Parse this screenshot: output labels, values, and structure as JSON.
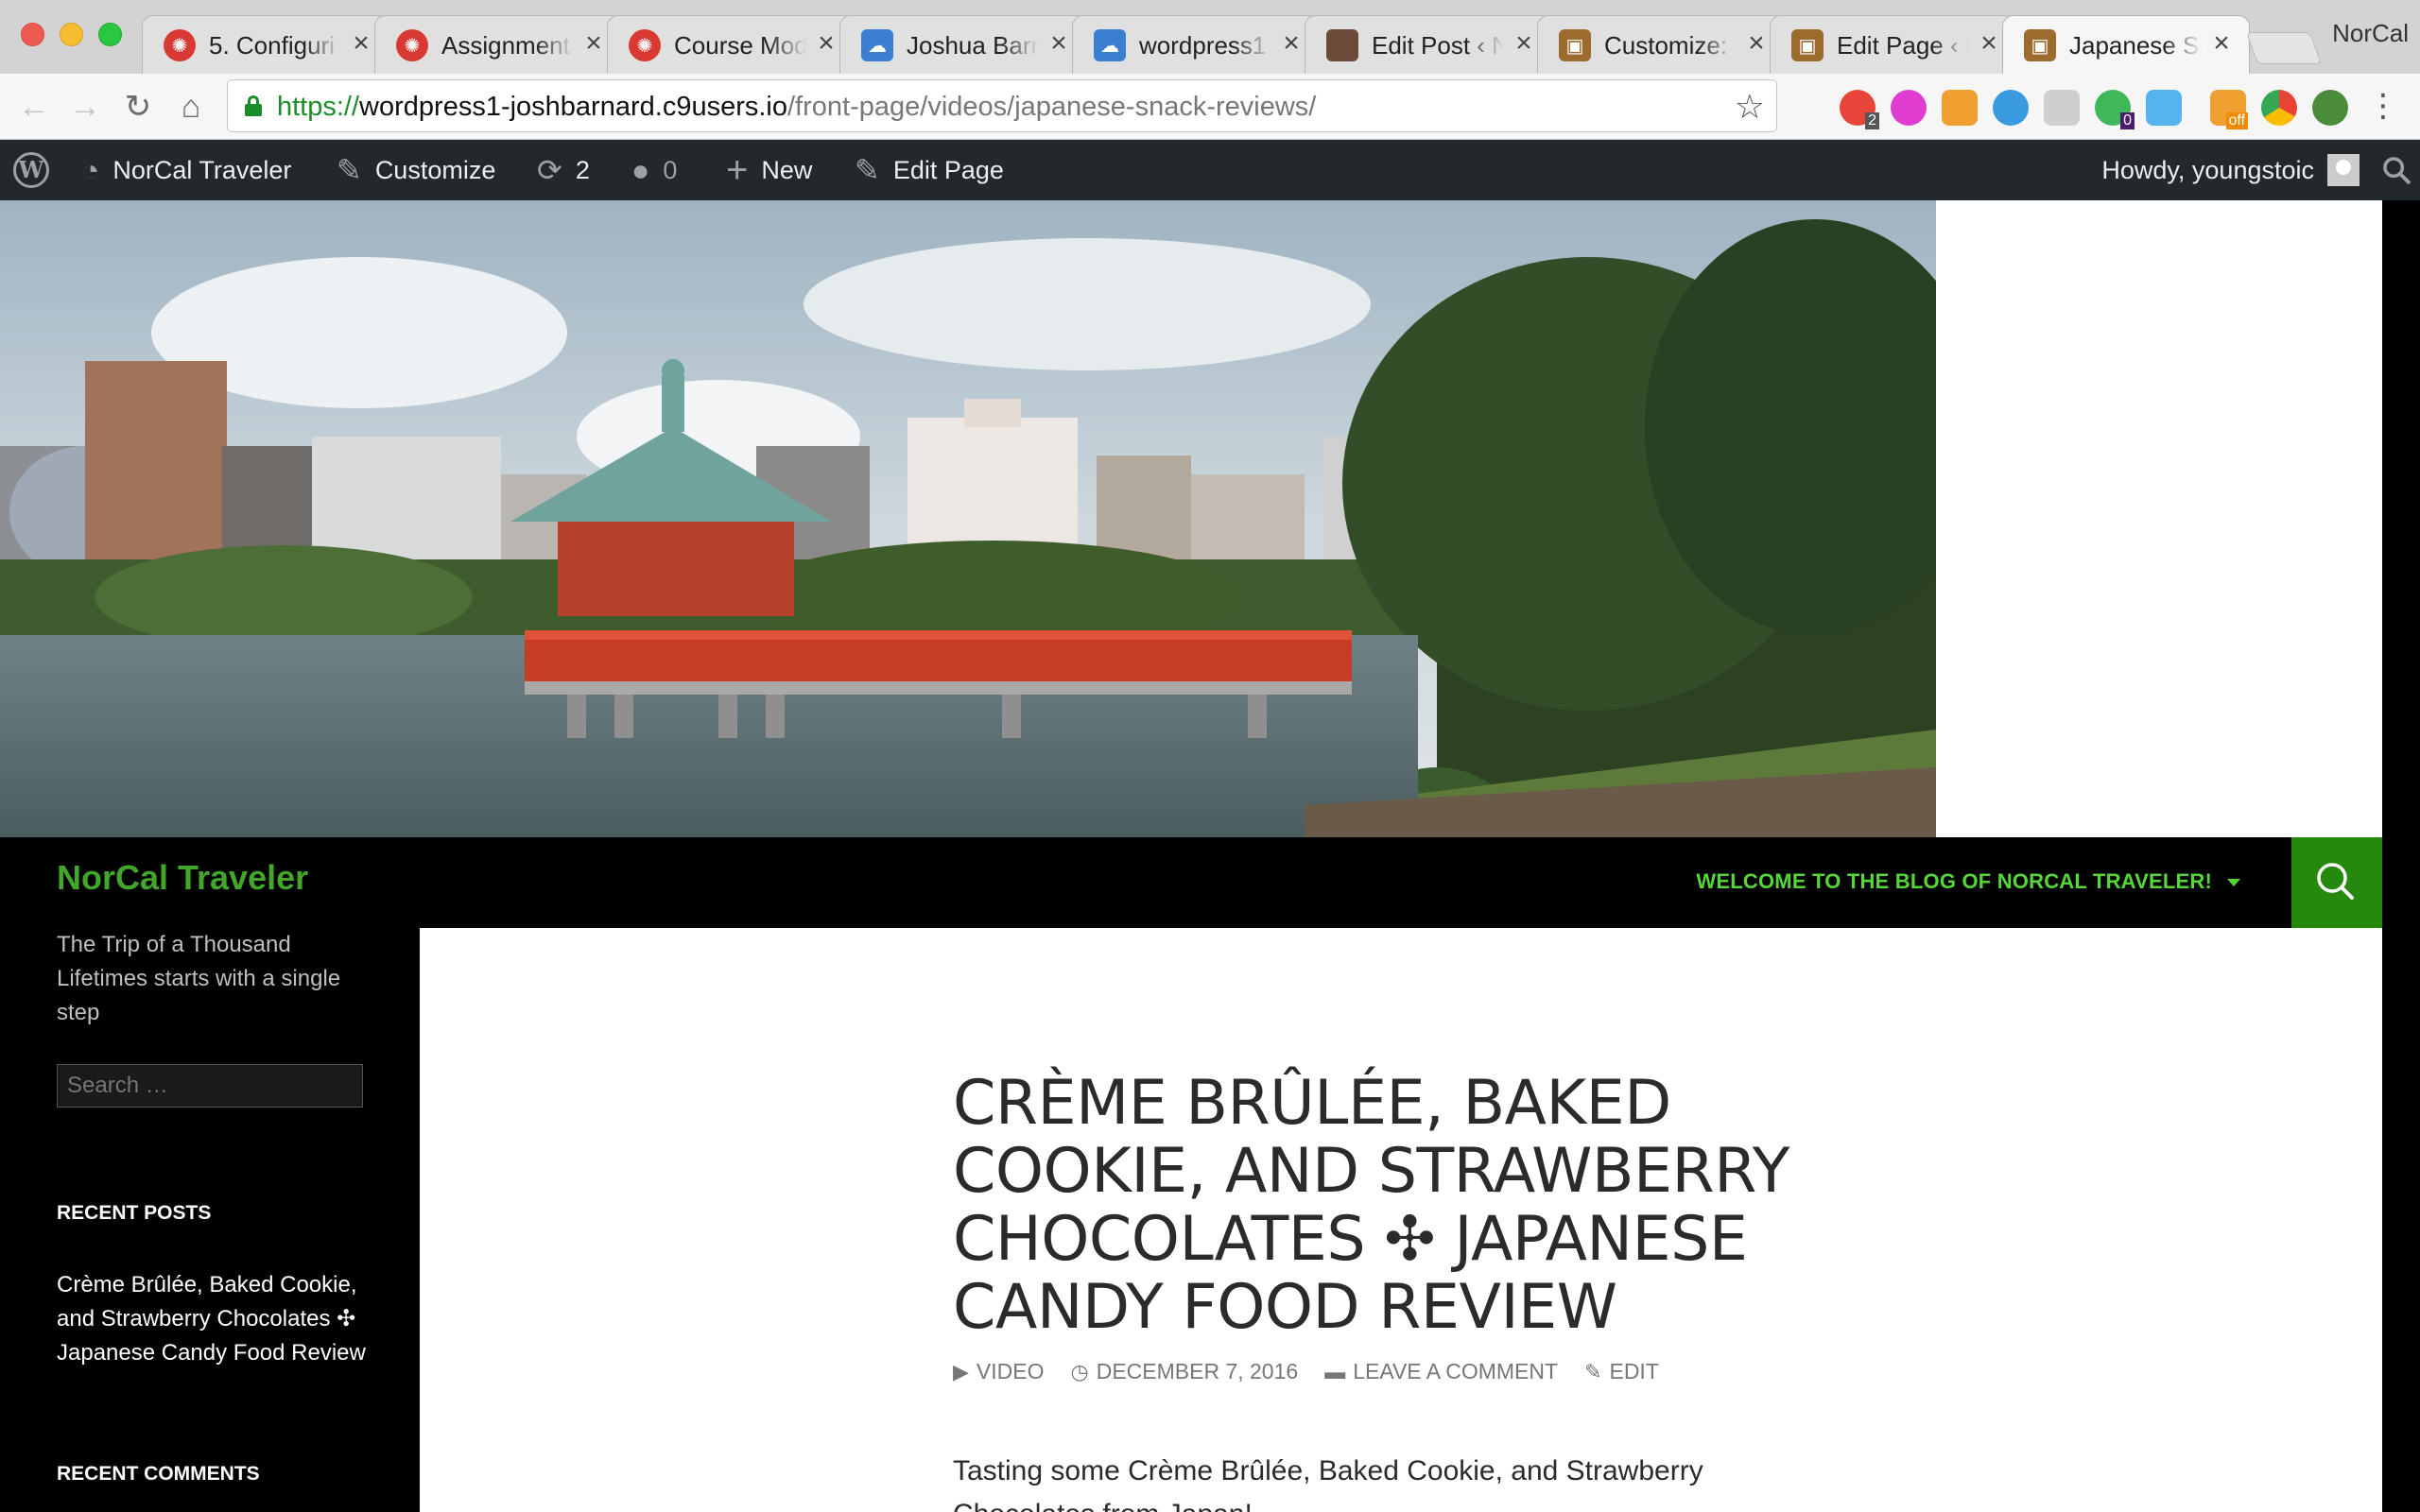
{
  "browser": {
    "tabs": [
      {
        "title": "5. Configuri",
        "favicon": "red-gear"
      },
      {
        "title": "Assignment",
        "favicon": "red-gear"
      },
      {
        "title": "Course Mod",
        "favicon": "red-gear"
      },
      {
        "title": "Joshua Barn",
        "favicon": "cloud9"
      },
      {
        "title": "wordpress1",
        "favicon": "cloud9"
      },
      {
        "title": "Edit Post ‹ N",
        "favicon": "avatar"
      },
      {
        "title": "Customize: ",
        "favicon": "suitcase"
      },
      {
        "title": "Edit Page ‹ N",
        "favicon": "suitcase"
      },
      {
        "title": "Japanese Sn",
        "favicon": "suitcase"
      }
    ],
    "profile_name": "NorCal",
    "url_scheme": "https://",
    "url_host": "wordpress1-joshbarnard.c9users.io",
    "url_path": "/front-page/videos/japanese-snack-reviews/",
    "extension_badges": {
      "ext1": "2",
      "ext7": "0",
      "ext9": "off"
    }
  },
  "adminbar": {
    "site_name": "NorCal Traveler",
    "customize": "Customize",
    "updates_count": "2",
    "comments_count": "0",
    "new": "New",
    "edit_page": "Edit Page",
    "greeting": "Howdy, youngstoic"
  },
  "site": {
    "title": "NorCal Traveler",
    "description": "The Trip of a Thousand Lifetimes starts with a single step",
    "nav_item": "Welcome to the blog of NorCal Traveler!",
    "accent_color": "#24890d"
  },
  "sidebar": {
    "search_placeholder": "Search …",
    "recent_posts_title": "Recent Posts",
    "recent_post_1": "Crème Brûlée, Baked Cookie, and Strawberry Chocolates ✣ Japanese Candy Food Review",
    "recent_comments_title": "Recent Comments"
  },
  "post": {
    "title": "Crème Brûlée, Baked Cookie, and Strawberry Chocolates ✣ Japanese Candy Food Review",
    "format": "Video",
    "date": "December 7, 2016",
    "comments": "Leave a comment",
    "edit": "Edit",
    "excerpt": "Tasting some Crème Brûlée, Baked Cookie, and Strawberry Chocolates from Japan!"
  }
}
